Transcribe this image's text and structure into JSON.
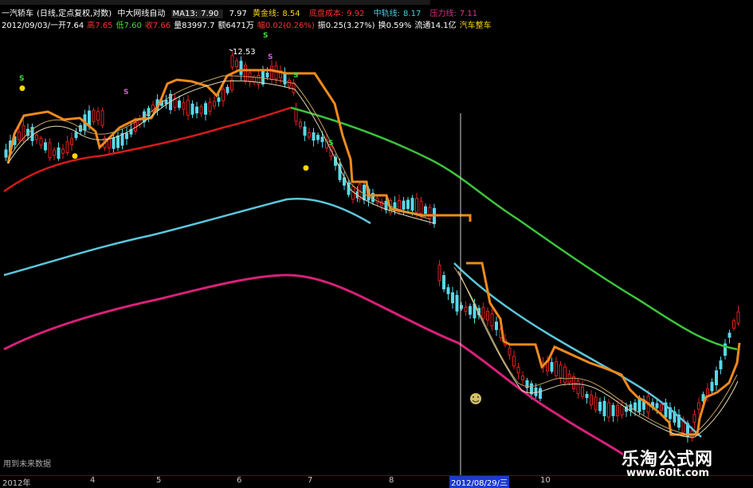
{
  "info_line1": {
    "name": "一汽轿车",
    "mode": "(日线,定点复权,对数)",
    "indicator": "中大网线自动",
    "ma13_label": "MA13:",
    "ma13_value": "7.90",
    "v2": "7.97",
    "gold_label": "黄金线:",
    "gold_value": "8.54",
    "defend_label": "底盘成本:",
    "defend_value": "9.92",
    "mid_label": "中轨线:",
    "mid_value": "8.17",
    "last_label": "压力线:",
    "last_value": "7.11"
  },
  "info_line2": {
    "date": "2012/09/03/一",
    "open": "开7.64",
    "high": "高7.65",
    "low": "低7.60",
    "close": "收7.66",
    "volume": "量83997.7",
    "amount": "额6471万",
    "change": "幅0.02(0.26%)",
    "amp": "振0.25(3.27%)",
    "turnover": "换0.59%",
    "float": "流通14.1亿",
    "sector": "汽车整车"
  },
  "annotation_high": "12.53",
  "footer_note": "用到未来数据",
  "x_axis": {
    "labels": [
      "2012年",
      "4",
      "5",
      "6",
      "7",
      "8",
      "2012/08/29/三",
      "10"
    ]
  },
  "watermark": {
    "cn": "乐淘公式网",
    "url": "www.60lt.com"
  },
  "colors": {
    "orange": "#f08a1c",
    "red": "#d81a1a",
    "cyan": "#5cc6dc",
    "green": "#3cc43c",
    "magenta": "#d8207a",
    "candle_up": "#e02020",
    "candle_down": "#58d8e8"
  }
}
